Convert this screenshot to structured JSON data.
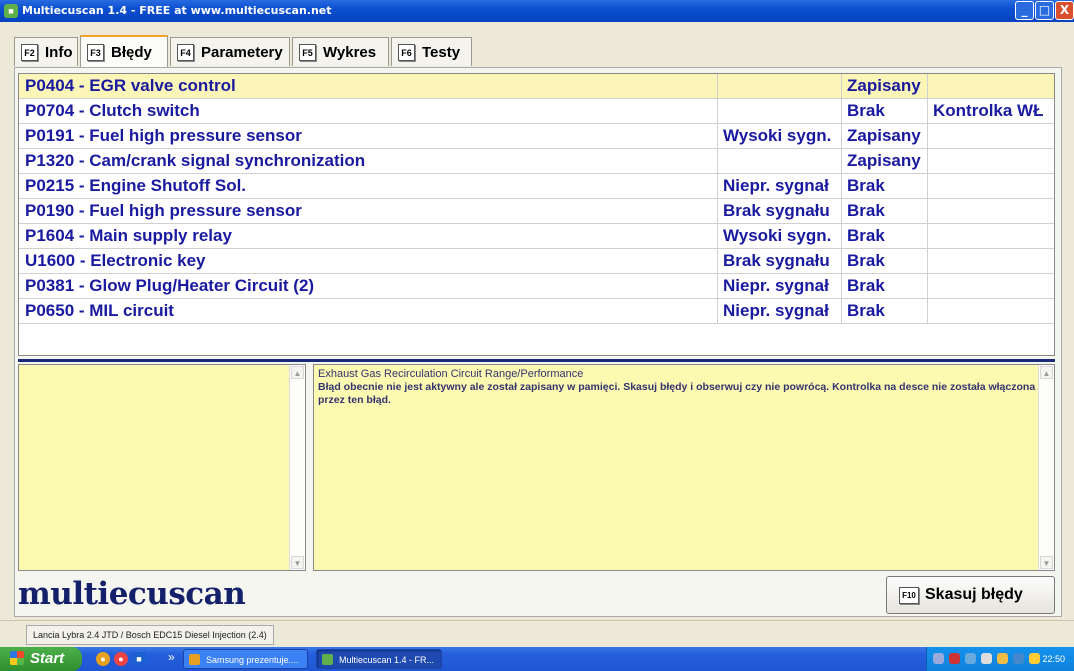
{
  "window": {
    "title": "Multiecuscan 1.4 - FREE at www.multiecuscan.net",
    "minimize_glyph": "_",
    "maximize_glyph": "□",
    "close_glyph": "X"
  },
  "tabs": [
    {
      "key": "F2",
      "label": "Info"
    },
    {
      "key": "F3",
      "label": "Błędy"
    },
    {
      "key": "F4",
      "label": "Parametery"
    },
    {
      "key": "F5",
      "label": "Wykres"
    },
    {
      "key": "F6",
      "label": "Testy"
    }
  ],
  "active_tab": "Błędy",
  "dtc_table": {
    "rows": [
      {
        "code": "P0404 - EGR valve control",
        "signal": "",
        "status": "Zapisany",
        "lamp": ""
      },
      {
        "code": "P0704 - Clutch switch",
        "signal": "",
        "status": "Brak",
        "lamp": "Kontrolka WŁ"
      },
      {
        "code": "P0191 - Fuel high pressure sensor",
        "signal": "Wysoki sygn.",
        "status": "Zapisany",
        "lamp": ""
      },
      {
        "code": "P1320 - Cam/crank signal synchronization",
        "signal": "",
        "status": "Zapisany",
        "lamp": ""
      },
      {
        "code": "P0215 - Engine Shutoff Sol.",
        "signal": "Niepr. sygnał",
        "status": "Brak",
        "lamp": ""
      },
      {
        "code": "P0190 - Fuel high pressure sensor",
        "signal": "Brak sygnału",
        "status": "Brak",
        "lamp": ""
      },
      {
        "code": "P1604 - Main supply relay",
        "signal": "Wysoki sygn.",
        "status": "Brak",
        "lamp": ""
      },
      {
        "code": "U1600 - Electronic key",
        "signal": "Brak sygnału",
        "status": "Brak",
        "lamp": ""
      },
      {
        "code": "P0381 - Glow Plug/Heater Circuit (2)",
        "signal": "Niepr. sygnał",
        "status": "Brak",
        "lamp": ""
      },
      {
        "code": "P0650 - MIL circuit",
        "signal": "Niepr. sygnał",
        "status": "Brak",
        "lamp": ""
      }
    ],
    "selected_row": 0
  },
  "description": {
    "title": "Exhaust Gas Recirculation Circuit Range/Performance",
    "text": "Błąd obecnie nie jest aktywny ale został zapisany w pamięci. Skasuj błędy i obserwuj czy nie powrócą. Kontrolka na desce nie została włączona przez ten błąd."
  },
  "logo_text": "multiecuscan",
  "clear_button": {
    "key": "F10",
    "label": "Skasuj błędy"
  },
  "status_bar": {
    "vehicle": "Lancia Lybra 2.4 JTD / Bosch EDC15 Diesel Injection (2.4)"
  },
  "taskbar": {
    "start_label": "Start",
    "chevron": "»",
    "tasks": [
      "Samsung prezentuje....",
      "Multiecuscan 1.4 - FR..."
    ],
    "clock": "22:50"
  },
  "colors": {
    "selected_row": "#fbf6b8",
    "text_blue": "#1a1aa0",
    "note_yellow": "#fcf9b0",
    "title_bar": "#0a4fd0",
    "tab_highlight": "#f4a32a"
  }
}
